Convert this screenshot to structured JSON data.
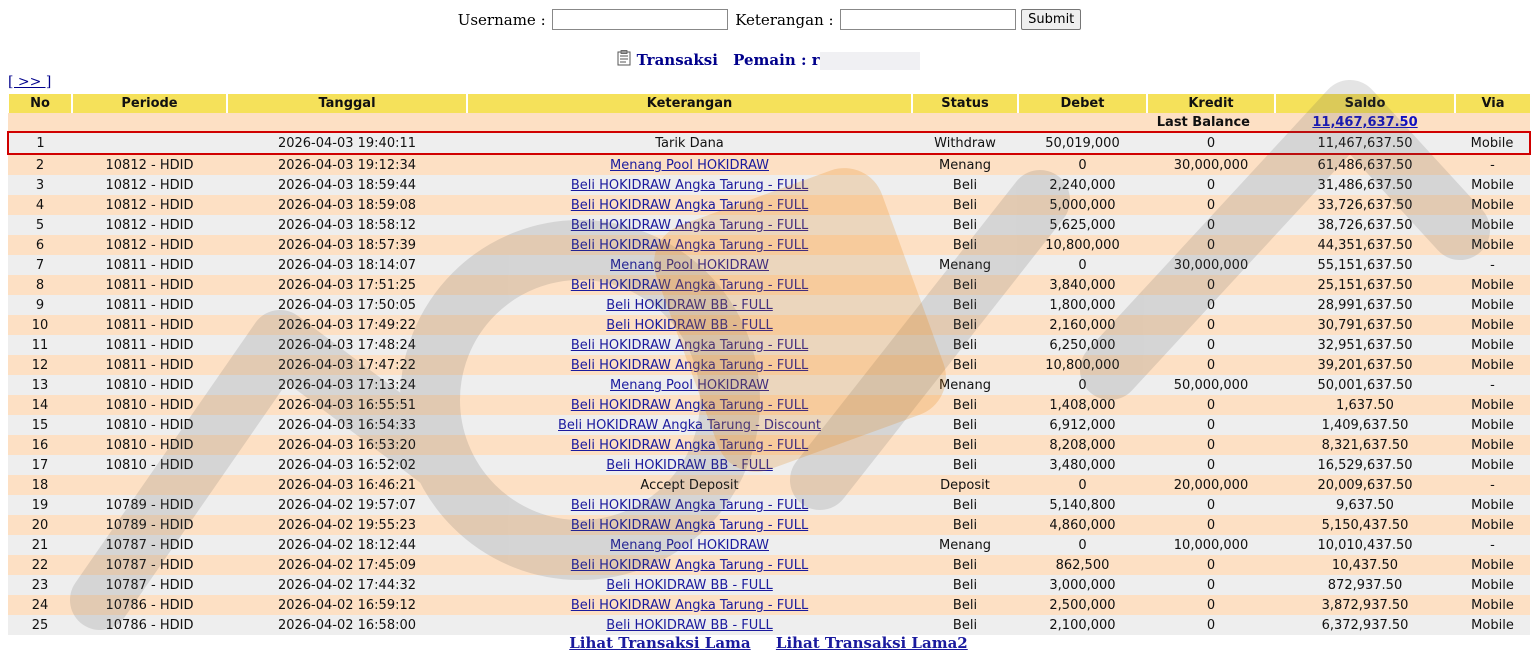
{
  "form": {
    "username_label": "Username :",
    "username_value": "",
    "keterangan_label": "Keterangan :",
    "keterangan_value": "",
    "submit_label": "Submit"
  },
  "title": {
    "icon": "clipboard-icon",
    "transaksi": "Transaksi",
    "pemain_label": "Pemain : r"
  },
  "nav_next": "[ >> ]",
  "columns": [
    "No",
    "Periode",
    "Tanggal",
    "Keterangan",
    "Status",
    "Debet",
    "Kredit",
    "Saldo",
    "Via"
  ],
  "last_balance": {
    "label": "Last Balance",
    "value": "11,467,637.50"
  },
  "rows": [
    {
      "no": "1",
      "periode": "",
      "tanggal": "2026-04-03 19:40:11",
      "ket": "Tarik Dana",
      "link": false,
      "status": "Withdraw",
      "debet": "50,019,000",
      "kredit": "0",
      "saldo": "11,467,637.50",
      "via": "Mobile"
    },
    {
      "no": "2",
      "periode": "10812 - HDID",
      "tanggal": "2026-04-03 19:12:34",
      "ket": "Menang Pool HOKIDRAW",
      "link": true,
      "status": "Menang",
      "debet": "0",
      "kredit": "30,000,000",
      "saldo": "61,486,637.50",
      "via": "-"
    },
    {
      "no": "3",
      "periode": "10812 - HDID",
      "tanggal": "2026-04-03 18:59:44",
      "ket": "Beli HOKIDRAW Angka Tarung - FULL",
      "link": true,
      "status": "Beli",
      "debet": "2,240,000",
      "kredit": "0",
      "saldo": "31,486,637.50",
      "via": "Mobile"
    },
    {
      "no": "4",
      "periode": "10812 - HDID",
      "tanggal": "2026-04-03 18:59:08",
      "ket": "Beli HOKIDRAW Angka Tarung - FULL",
      "link": true,
      "status": "Beli",
      "debet": "5,000,000",
      "kredit": "0",
      "saldo": "33,726,637.50",
      "via": "Mobile"
    },
    {
      "no": "5",
      "periode": "10812 - HDID",
      "tanggal": "2026-04-03 18:58:12",
      "ket": "Beli HOKIDRAW Angka Tarung - FULL",
      "link": true,
      "status": "Beli",
      "debet": "5,625,000",
      "kredit": "0",
      "saldo": "38,726,637.50",
      "via": "Mobile"
    },
    {
      "no": "6",
      "periode": "10812 - HDID",
      "tanggal": "2026-04-03 18:57:39",
      "ket": "Beli HOKIDRAW Angka Tarung - FULL",
      "link": true,
      "status": "Beli",
      "debet": "10,800,000",
      "kredit": "0",
      "saldo": "44,351,637.50",
      "via": "Mobile"
    },
    {
      "no": "7",
      "periode": "10811 - HDID",
      "tanggal": "2026-04-03 18:14:07",
      "ket": "Menang Pool HOKIDRAW",
      "link": true,
      "status": "Menang",
      "debet": "0",
      "kredit": "30,000,000",
      "saldo": "55,151,637.50",
      "via": "-"
    },
    {
      "no": "8",
      "periode": "10811 - HDID",
      "tanggal": "2026-04-03 17:51:25",
      "ket": "Beli HOKIDRAW Angka Tarung - FULL",
      "link": true,
      "status": "Beli",
      "debet": "3,840,000",
      "kredit": "0",
      "saldo": "25,151,637.50",
      "via": "Mobile"
    },
    {
      "no": "9",
      "periode": "10811 - HDID",
      "tanggal": "2026-04-03 17:50:05",
      "ket": "Beli HOKIDRAW BB - FULL",
      "link": true,
      "status": "Beli",
      "debet": "1,800,000",
      "kredit": "0",
      "saldo": "28,991,637.50",
      "via": "Mobile"
    },
    {
      "no": "10",
      "periode": "10811 - HDID",
      "tanggal": "2026-04-03 17:49:22",
      "ket": "Beli HOKIDRAW BB - FULL",
      "link": true,
      "status": "Beli",
      "debet": "2,160,000",
      "kredit": "0",
      "saldo": "30,791,637.50",
      "via": "Mobile"
    },
    {
      "no": "11",
      "periode": "10811 - HDID",
      "tanggal": "2026-04-03 17:48:24",
      "ket": "Beli HOKIDRAW Angka Tarung - FULL",
      "link": true,
      "status": "Beli",
      "debet": "6,250,000",
      "kredit": "0",
      "saldo": "32,951,637.50",
      "via": "Mobile"
    },
    {
      "no": "12",
      "periode": "10811 - HDID",
      "tanggal": "2026-04-03 17:47:22",
      "ket": "Beli HOKIDRAW Angka Tarung - FULL",
      "link": true,
      "status": "Beli",
      "debet": "10,800,000",
      "kredit": "0",
      "saldo": "39,201,637.50",
      "via": "Mobile"
    },
    {
      "no": "13",
      "periode": "10810 - HDID",
      "tanggal": "2026-04-03 17:13:24",
      "ket": "Menang Pool HOKIDRAW",
      "link": true,
      "status": "Menang",
      "debet": "0",
      "kredit": "50,000,000",
      "saldo": "50,001,637.50",
      "via": "-"
    },
    {
      "no": "14",
      "periode": "10810 - HDID",
      "tanggal": "2026-04-03 16:55:51",
      "ket": "Beli HOKIDRAW Angka Tarung - FULL",
      "link": true,
      "status": "Beli",
      "debet": "1,408,000",
      "kredit": "0",
      "saldo": "1,637.50",
      "via": "Mobile"
    },
    {
      "no": "15",
      "periode": "10810 - HDID",
      "tanggal": "2026-04-03 16:54:33",
      "ket": "Beli HOKIDRAW Angka Tarung - Discount",
      "link": true,
      "status": "Beli",
      "debet": "6,912,000",
      "kredit": "0",
      "saldo": "1,409,637.50",
      "via": "Mobile"
    },
    {
      "no": "16",
      "periode": "10810 - HDID",
      "tanggal": "2026-04-03 16:53:20",
      "ket": "Beli HOKIDRAW Angka Tarung - FULL",
      "link": true,
      "status": "Beli",
      "debet": "8,208,000",
      "kredit": "0",
      "saldo": "8,321,637.50",
      "via": "Mobile"
    },
    {
      "no": "17",
      "periode": "10810 - HDID",
      "tanggal": "2026-04-03 16:52:02",
      "ket": "Beli HOKIDRAW BB - FULL",
      "link": true,
      "status": "Beli",
      "debet": "3,480,000",
      "kredit": "0",
      "saldo": "16,529,637.50",
      "via": "Mobile"
    },
    {
      "no": "18",
      "periode": "",
      "tanggal": "2026-04-03 16:46:21",
      "ket": "Accept Deposit",
      "link": false,
      "status": "Deposit",
      "debet": "0",
      "kredit": "20,000,000",
      "saldo": "20,009,637.50",
      "via": "-"
    },
    {
      "no": "19",
      "periode": "10789 - HDID",
      "tanggal": "2026-04-02 19:57:07",
      "ket": "Beli HOKIDRAW Angka Tarung - FULL",
      "link": true,
      "status": "Beli",
      "debet": "5,140,800",
      "kredit": "0",
      "saldo": "9,637.50",
      "via": "Mobile"
    },
    {
      "no": "20",
      "periode": "10789 - HDID",
      "tanggal": "2026-04-02 19:55:23",
      "ket": "Beli HOKIDRAW Angka Tarung - FULL",
      "link": true,
      "status": "Beli",
      "debet": "4,860,000",
      "kredit": "0",
      "saldo": "5,150,437.50",
      "via": "Mobile"
    },
    {
      "no": "21",
      "periode": "10787 - HDID",
      "tanggal": "2026-04-02 18:12:44",
      "ket": "Menang Pool HOKIDRAW",
      "link": true,
      "status": "Menang",
      "debet": "0",
      "kredit": "10,000,000",
      "saldo": "10,010,437.50",
      "via": "-"
    },
    {
      "no": "22",
      "periode": "10787 - HDID",
      "tanggal": "2026-04-02 17:45:09",
      "ket": "Beli HOKIDRAW Angka Tarung - FULL",
      "link": true,
      "status": "Beli",
      "debet": "862,500",
      "kredit": "0",
      "saldo": "10,437.50",
      "via": "Mobile"
    },
    {
      "no": "23",
      "periode": "10787 - HDID",
      "tanggal": "2026-04-02 17:44:32",
      "ket": "Beli HOKIDRAW BB - FULL",
      "link": true,
      "status": "Beli",
      "debet": "3,000,000",
      "kredit": "0",
      "saldo": "872,937.50",
      "via": "Mobile"
    },
    {
      "no": "24",
      "periode": "10786 - HDID",
      "tanggal": "2026-04-02 16:59:12",
      "ket": "Beli HOKIDRAW Angka Tarung - FULL",
      "link": true,
      "status": "Beli",
      "debet": "2,500,000",
      "kredit": "0",
      "saldo": "3,872,937.50",
      "via": "Mobile"
    },
    {
      "no": "25",
      "periode": "10786 - HDID",
      "tanggal": "2026-04-02 16:58:00",
      "ket": "Beli HOKIDRAW BB - FULL",
      "link": true,
      "status": "Beli",
      "debet": "2,100,000",
      "kredit": "0",
      "saldo": "6,372,937.50",
      "via": "Mobile"
    }
  ],
  "footer": {
    "link1": "Lihat Transaksi Lama",
    "link2": "Lihat Transaksi Lama2"
  },
  "colors": {
    "header_bg": "#f5e15a",
    "row_even": "#fde0c4",
    "row_odd": "#eeeeee",
    "status_red": "#d80000",
    "link_blue": "#1a1a9e",
    "highlight": "#d00000"
  }
}
